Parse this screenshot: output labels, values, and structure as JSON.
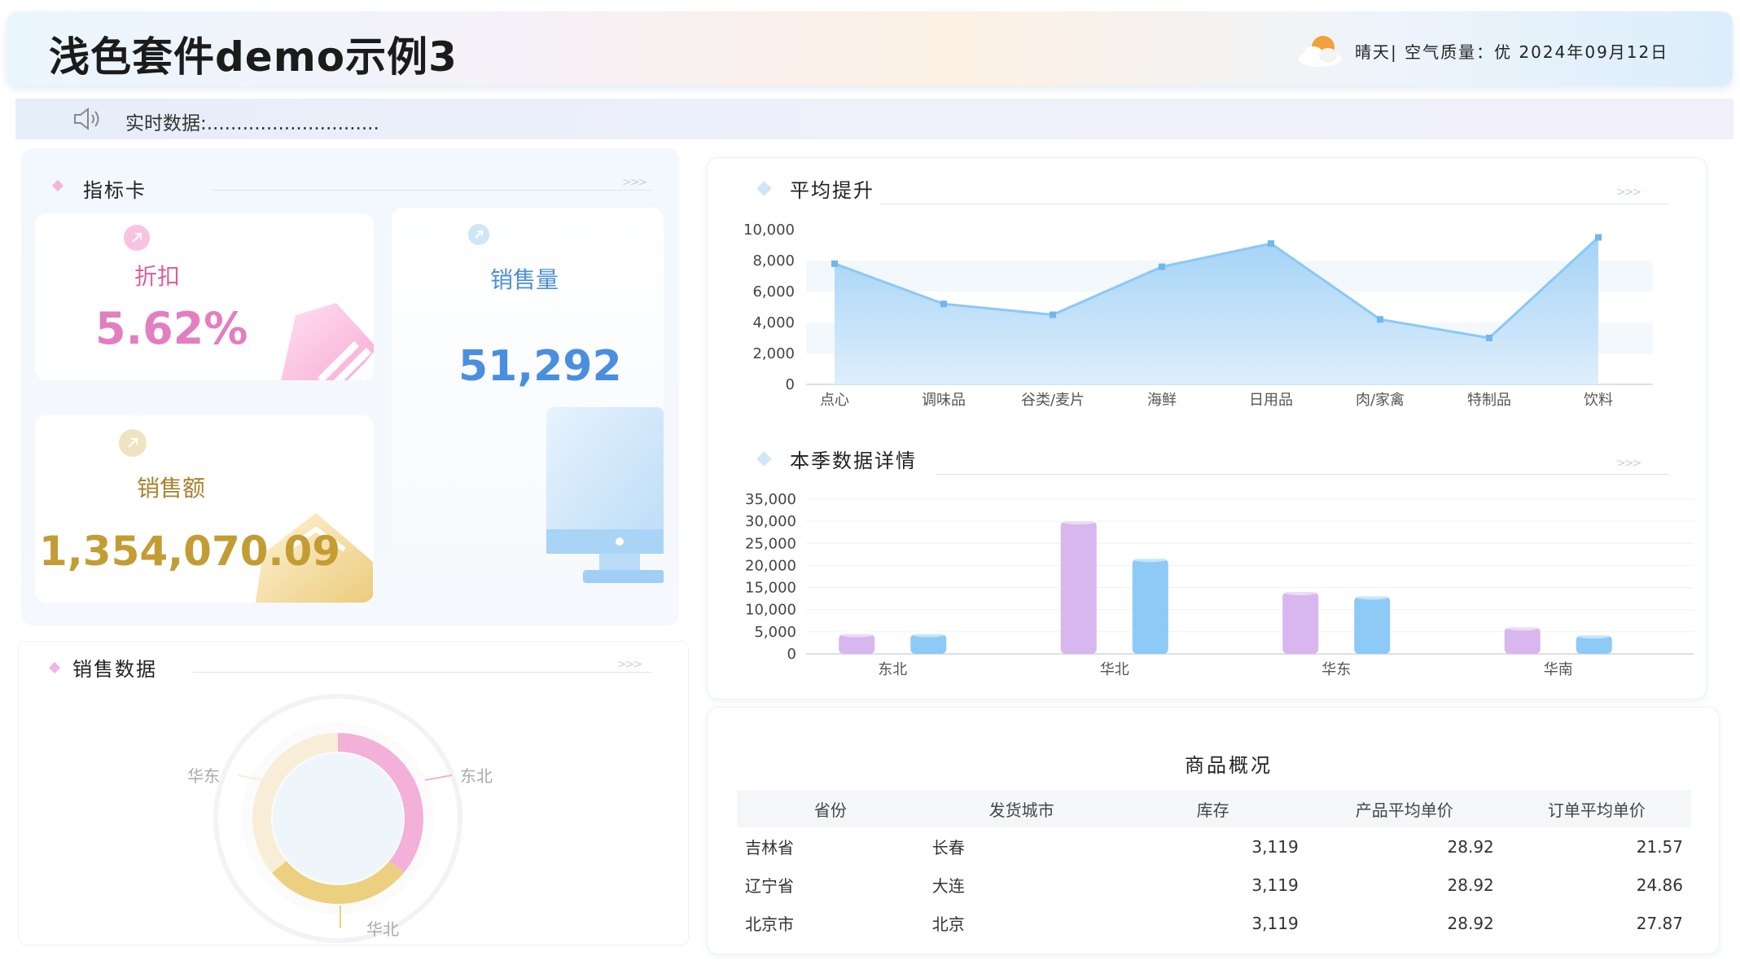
{
  "header": {
    "title": "浅色套件demo示例3",
    "weather_icon": "sun-cloud-icon",
    "weather_text": "晴天| 空气质量：优   2024年09月12日"
  },
  "ticker": {
    "icon": "speaker-icon",
    "text": "实时数据:............................."
  },
  "kpi": {
    "section_title": "指标卡",
    "cards": [
      {
        "label": "折扣",
        "value": "5.62%",
        "icon": "arrow-up-right-icon",
        "color": "#e07ab8"
      },
      {
        "label": "销售量",
        "value": "51,292",
        "icon": "arrow-up-right-icon",
        "color": "#4a90e2"
      },
      {
        "label": "销售额",
        "value": "1,354,070.09",
        "icon": "arrow-up-right-icon",
        "color": "#c8a03a"
      }
    ]
  },
  "sales": {
    "section_title": "销售数据",
    "labels": [
      "华东",
      "东北",
      "华北"
    ]
  },
  "charts": {
    "line_title": "平均提升",
    "bar_title": "本季数据详情"
  },
  "chart_data": [
    {
      "type": "area",
      "title": "平均提升",
      "categories": [
        "点心",
        "调味品",
        "谷类/麦片",
        "海鲜",
        "日用品",
        "肉/家禽",
        "特制品",
        "饮料"
      ],
      "values": [
        7800,
        5200,
        4500,
        7600,
        9100,
        4200,
        3000,
        9500
      ],
      "ylim": [
        0,
        10000
      ],
      "yticks": [
        "10,000",
        "8,000",
        "6,000",
        "4,000",
        "2,000",
        "0"
      ],
      "color": "#8cc8f5"
    },
    {
      "type": "bar",
      "title": "本季数据详情",
      "categories": [
        "东北",
        "华北",
        "华东",
        "华南"
      ],
      "series": [
        {
          "values": [
            4500,
            30000,
            14000,
            6000
          ],
          "color": "#d8b6ee"
        },
        {
          "values": [
            4500,
            21500,
            13000,
            4200
          ],
          "color": "#8dcaf5"
        }
      ],
      "ylim": [
        0,
        35000
      ],
      "yticks": [
        "35,000",
        "30,000",
        "25,000",
        "20,000",
        "15,000",
        "10,000",
        "5,000",
        "0"
      ]
    },
    {
      "type": "pie",
      "title": "销售数据",
      "labels": [
        "东北",
        "华北",
        "华东"
      ],
      "values": [
        36,
        28,
        36
      ],
      "colors": [
        "#f3b0d8",
        "#ecd07f",
        "#f8eed7"
      ]
    }
  ],
  "table": {
    "title": "商品概况",
    "columns": [
      "省份",
      "发货城市",
      "库存",
      "产品平均单价",
      "订单平均单价"
    ],
    "rows": [
      [
        "吉林省",
        "长春",
        "3,119",
        "28.92",
        "21.57"
      ],
      [
        "辽宁省",
        "大连",
        "3,119",
        "28.92",
        "24.86"
      ],
      [
        "北京市",
        "北京",
        "3,119",
        "28.92",
        "27.87"
      ]
    ]
  }
}
